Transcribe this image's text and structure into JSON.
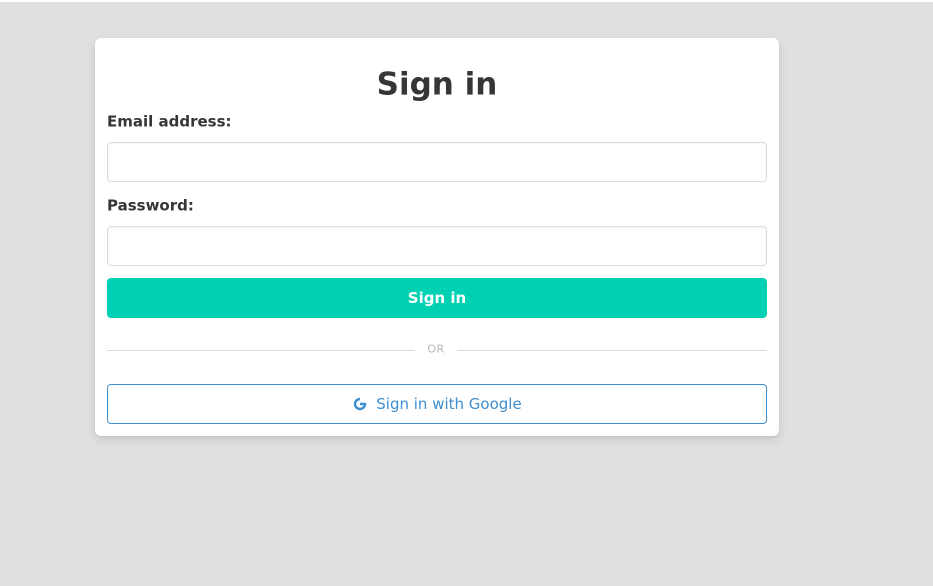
{
  "form": {
    "title": "Sign in",
    "email_label": "Email address:",
    "email_value": "",
    "email_placeholder": "",
    "password_label": "Password:",
    "password_value": "",
    "password_placeholder": "",
    "submit_label": "Sign in",
    "divider_text": "OR",
    "google_button_label": "Sign in with Google",
    "google_icon": "google-g-icon"
  },
  "colors": {
    "background": "#e0e0e0",
    "card": "#ffffff",
    "primary": "#00d1b2",
    "link": "#3e8ed0",
    "text": "#363636",
    "muted": "#b5b5b5",
    "border": "#dbdbdb"
  }
}
